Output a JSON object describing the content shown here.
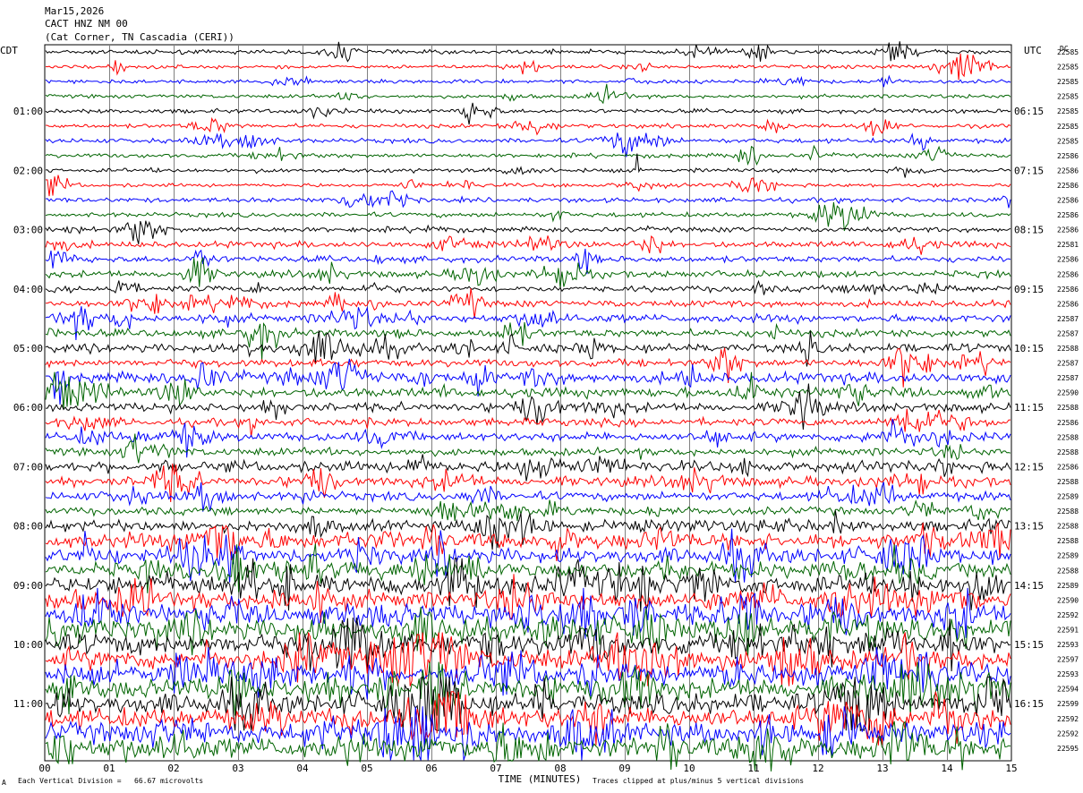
{
  "header": {
    "date": "Mar15,2026",
    "station": "CACT HNZ NM 00",
    "location": "(Cat Corner, TN Cascadia (CERI))"
  },
  "left_tz": "CDT",
  "right_tz": "UTC",
  "dc_label": "DC",
  "footer": {
    "scale_note": "Each Vertical Division =   66.67 microvolts",
    "clip_note": "Traces clipped at plus/minus 5 vertical divisions",
    "corner_mark": "A"
  },
  "colors": {
    "trace_cycle": [
      "#000000",
      "#ff0000",
      "#0000ff",
      "#006400"
    ],
    "grid": "#808080"
  },
  "chart_data": {
    "type": "line",
    "xlabel": "TIME (MINUTES)",
    "xlim": [
      0,
      15
    ],
    "x_ticks": [
      "00",
      "01",
      "02",
      "03",
      "04",
      "05",
      "06",
      "07",
      "08",
      "09",
      "10",
      "11",
      "12",
      "13",
      "14",
      "15"
    ],
    "left_time_labels": [
      "01:00",
      "02:00",
      "03:00",
      "04:00",
      "05:00",
      "06:00",
      "07:00",
      "08:00",
      "09:00",
      "10:00",
      "11:00"
    ],
    "right_time_labels": [
      "06:15",
      "07:15",
      "08:15",
      "09:15",
      "10:15",
      "11:15",
      "12:15",
      "13:15",
      "14:15",
      "15:15",
      "16:15"
    ],
    "dc_offsets": [
      "22585",
      "22585",
      "22585",
      "22585",
      "22585",
      "22585",
      "22585",
      "22586",
      "22586",
      "22586",
      "22586",
      "22586",
      "22586",
      "22581",
      "22586",
      "22586",
      "22586",
      "22586",
      "22587",
      "22587",
      "22588",
      "22587",
      "22587",
      "22590",
      "22588",
      "22586",
      "22588",
      "22588",
      "22586",
      "22588",
      "22589",
      "22588",
      "22588",
      "22588",
      "22589",
      "22588",
      "22589",
      "22590",
      "22592",
      "22591",
      "22593",
      "22597",
      "22593",
      "22594",
      "22599",
      "22592",
      "22592",
      "22595"
    ],
    "series": [
      {
        "color": "black",
        "activity": 0.15
      },
      {
        "color": "red",
        "activity": 0.1
      },
      {
        "color": "blue",
        "activity": 0.1
      },
      {
        "color": "green",
        "activity": 0.1
      },
      {
        "color": "black",
        "activity": 0.15
      },
      {
        "color": "red",
        "activity": 0.15
      },
      {
        "color": "blue",
        "activity": 0.2
      },
      {
        "color": "green",
        "activity": 0.15
      },
      {
        "color": "black",
        "activity": 0.15
      },
      {
        "color": "red",
        "activity": 0.1
      },
      {
        "color": "blue",
        "activity": 0.2
      },
      {
        "color": "green",
        "activity": 0.2
      },
      {
        "color": "black",
        "activity": 0.25
      },
      {
        "color": "red",
        "activity": 0.35
      },
      {
        "color": "blue",
        "activity": 0.35
      },
      {
        "color": "green",
        "activity": 0.4
      },
      {
        "color": "black",
        "activity": 0.35
      },
      {
        "color": "red",
        "activity": 0.4
      },
      {
        "color": "blue",
        "activity": 0.55
      },
      {
        "color": "green",
        "activity": 0.5
      },
      {
        "color": "black",
        "activity": 0.6
      },
      {
        "color": "red",
        "activity": 0.5
      },
      {
        "color": "blue",
        "activity": 0.8
      },
      {
        "color": "green",
        "activity": 0.7
      },
      {
        "color": "black",
        "activity": 0.6
      },
      {
        "color": "red",
        "activity": 0.5
      },
      {
        "color": "blue",
        "activity": 0.6
      },
      {
        "color": "green",
        "activity": 0.5
      },
      {
        "color": "black",
        "activity": 0.8
      },
      {
        "color": "red",
        "activity": 0.7
      },
      {
        "color": "blue",
        "activity": 0.6
      },
      {
        "color": "green",
        "activity": 0.5
      },
      {
        "color": "black",
        "activity": 0.8
      },
      {
        "color": "red",
        "activity": 1.3
      },
      {
        "color": "blue",
        "activity": 1.3
      },
      {
        "color": "green",
        "activity": 1.3
      },
      {
        "color": "black",
        "activity": 1.6
      },
      {
        "color": "red",
        "activity": 1.5
      },
      {
        "color": "blue",
        "activity": 1.7
      },
      {
        "color": "green",
        "activity": 1.8
      },
      {
        "color": "black",
        "activity": 1.8
      },
      {
        "color": "red",
        "activity": 1.8
      },
      {
        "color": "blue",
        "activity": 1.8
      },
      {
        "color": "green",
        "activity": 1.8
      },
      {
        "color": "black",
        "activity": 1.8
      },
      {
        "color": "red",
        "activity": 1.8
      },
      {
        "color": "blue",
        "activity": 1.8
      },
      {
        "color": "green",
        "activity": 1.8
      }
    ]
  }
}
